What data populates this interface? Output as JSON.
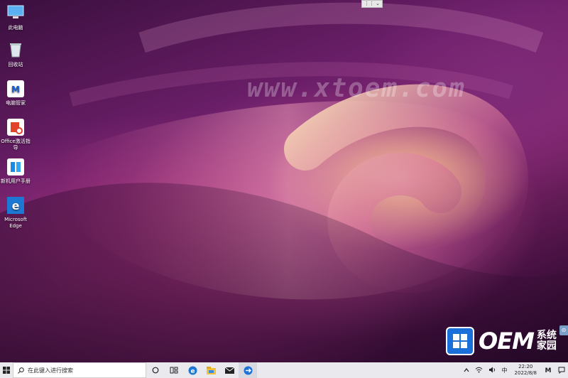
{
  "desktop": {
    "watermark": "www.xtoem.com",
    "icons": [
      {
        "label": "此电脑",
        "icon": "computer-icon"
      },
      {
        "label": "回收站",
        "icon": "recycle-bin-icon"
      },
      {
        "label": "电脑管家",
        "icon": "pc-manager-icon"
      },
      {
        "label": "Office激活指导",
        "icon": "office-icon"
      },
      {
        "label": "新机用户手册",
        "icon": "user-manual-icon"
      },
      {
        "label": "Microsoft Edge",
        "icon": "edge-icon"
      }
    ],
    "brand": {
      "text": "OEM",
      "cn": "系统家园"
    }
  },
  "taskbar": {
    "search_placeholder": "在此键入进行搜索",
    "apps": [
      "task-view-icon",
      "multitask-icon",
      "edge-icon",
      "file-explorer-icon",
      "mail-icon",
      "remote-icon"
    ],
    "tray": {
      "ime": "中",
      "time": "22:20",
      "date": "2022/8/8"
    }
  },
  "colors": {
    "taskbar_bg": "#e9e9ee",
    "brand_blue": "#1a6fd8"
  }
}
